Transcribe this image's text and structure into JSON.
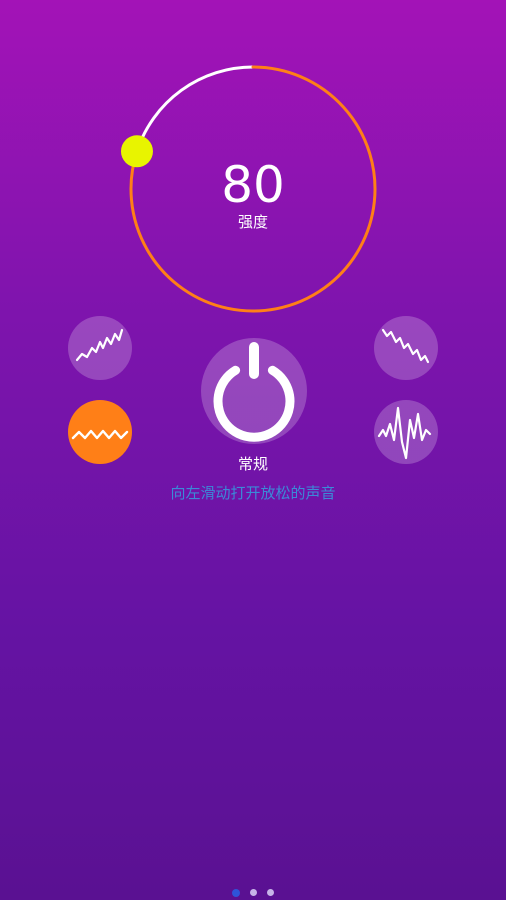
{
  "intensity": {
    "value": "80",
    "label": "强度",
    "level": 80,
    "max": 100
  },
  "modes": [
    {
      "name": "rising-wave-icon",
      "active": false
    },
    {
      "name": "falling-wave-icon",
      "active": false
    },
    {
      "name": "zigzag-wave-icon",
      "active": true
    },
    {
      "name": "pulse-wave-icon",
      "active": false
    }
  ],
  "power": {
    "icon": "power-icon"
  },
  "mode_name": "常规",
  "hint": "向左滑动打开放松的声音",
  "pager": {
    "count": 3,
    "active_index": 0
  },
  "colors": {
    "background_top": "#a313b7",
    "background_bottom": "#5a1192",
    "arc_active": "#ff7f17",
    "arc_remaining": "#ffffff",
    "knob": "#e8f400",
    "active_mode": "#ff7f17",
    "hint_text": "#3b8ad8",
    "pager_active": "#2f53d9"
  }
}
